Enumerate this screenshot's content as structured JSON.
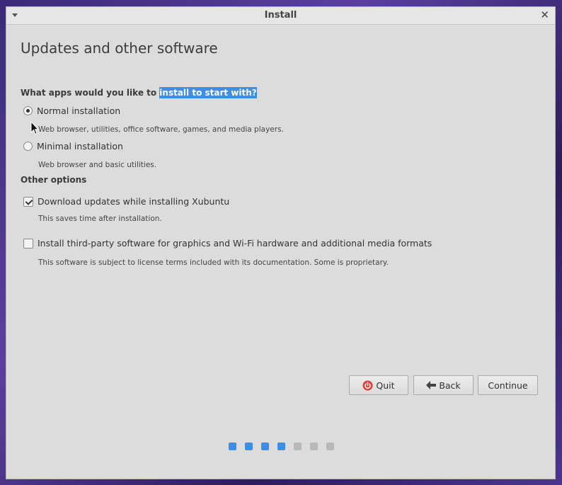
{
  "window": {
    "title": "Install"
  },
  "page": {
    "title": "Updates and other software"
  },
  "question": {
    "prefix": "What apps would you like to ",
    "selected": "install to start with?"
  },
  "options": {
    "normal": {
      "label": "Normal installation",
      "desc": "Web browser, utilities, office software, games, and media players.",
      "checked": true
    },
    "minimal": {
      "label": "Minimal installation",
      "desc": "Web browser and basic utilities.",
      "checked": false
    }
  },
  "other": {
    "heading": "Other options",
    "updates": {
      "label": "Download updates while installing Xubuntu",
      "desc": "This saves time after installation.",
      "checked": true
    },
    "thirdparty": {
      "label": "Install third-party software for graphics and Wi-Fi hardware and additional media formats",
      "desc": "This software is subject to license terms included with its documentation. Some is proprietary.",
      "checked": false
    }
  },
  "buttons": {
    "quit": "Quit",
    "back": "Back",
    "continue": "Continue"
  },
  "progress": {
    "steps": 7,
    "completed": 4,
    "active_color": "#3d8ee6",
    "inactive_color": "#b8b8b8"
  }
}
